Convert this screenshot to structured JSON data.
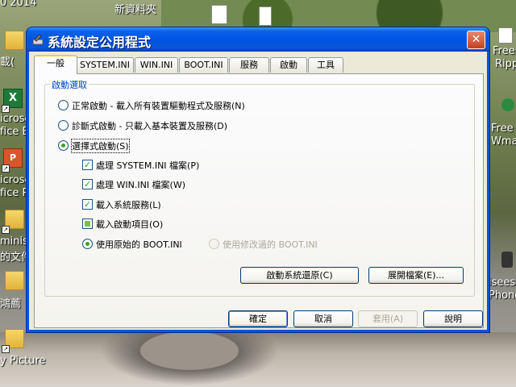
{
  "window": {
    "title": "系統設定公用程式",
    "close_glyph": "✕"
  },
  "tabs": [
    {
      "label": "一般",
      "active": true
    },
    {
      "label": "SYSTEM.INI",
      "active": false
    },
    {
      "label": "WIN.INI",
      "active": false
    },
    {
      "label": "BOOT.INI",
      "active": false
    },
    {
      "label": "服務",
      "active": false
    },
    {
      "label": "啟動",
      "active": false
    },
    {
      "label": "工具",
      "active": false
    }
  ],
  "startup_group": {
    "legend": "啟動選取",
    "options": [
      {
        "label": "正常啟動 - 載入所有裝置驅動程式及服務(N)",
        "selected": false
      },
      {
        "label": "診斷式啟動 - 只載入基本裝置及服務(D)",
        "selected": false
      },
      {
        "label": "選擇式啟動(S)",
        "selected": true
      }
    ],
    "selective_items": [
      {
        "label": "處理 SYSTEM.INI 檔案(P)",
        "state": "checked"
      },
      {
        "label": "處理 WIN.INI 檔案(W)",
        "state": "checked"
      },
      {
        "label": "載入系統服務(L)",
        "state": "checked"
      },
      {
        "label": "載入啟動項目(O)",
        "state": "indeterminate"
      }
    ],
    "boot_options": [
      {
        "label": "使用原始的 BOOT.INI",
        "selected": true,
        "enabled": true
      },
      {
        "label": "使用修改過的 BOOT.INI",
        "selected": false,
        "enabled": false
      }
    ],
    "buttons": {
      "restore": "啟動系統還原(C)",
      "expand": "展開檔案(E)..."
    }
  },
  "footer_buttons": {
    "ok": "確定",
    "cancel": "取消",
    "apply": "套用(A)",
    "help": "說明"
  },
  "desktop": {
    "labels": [
      "0 2014",
      "新資料夾",
      "載(",
      "icroso",
      "fice E",
      "icroso",
      "fice P",
      "minis",
      "的文件",
      "鴻薦",
      "y Picture",
      "Free",
      "Ripp",
      "Free",
      "Wma",
      "iseesa",
      "Phone"
    ]
  },
  "colors": {
    "titlebar": "#0054e3",
    "dialog_face": "#ece9d8",
    "group_legend": "#0046d5",
    "close_button": "#c3411f"
  }
}
